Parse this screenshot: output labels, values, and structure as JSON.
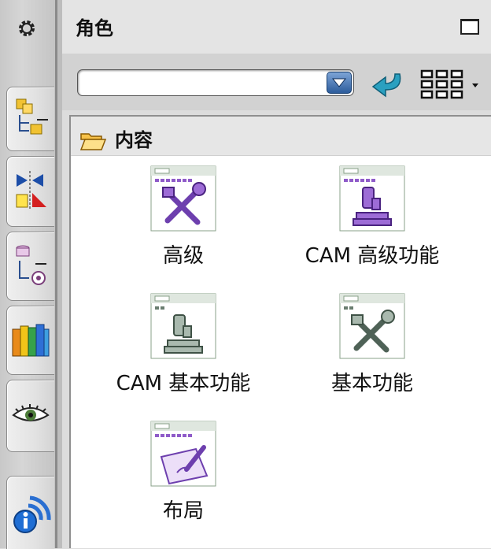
{
  "panel": {
    "title": "角色"
  },
  "toolbar": {
    "combo_value": ""
  },
  "group": {
    "label": "内容"
  },
  "items": [
    {
      "label": "高级",
      "icon": "tools-role-icon"
    },
    {
      "label": "CAM 高级功能",
      "icon": "microscope-role-icon"
    },
    {
      "label": "CAM 基本功能",
      "icon": "microscope-role-icon"
    },
    {
      "label": "基本功能",
      "icon": "tools-role-icon"
    },
    {
      "label": "布局",
      "icon": "pencil-layout-icon"
    }
  ],
  "sidebar_tabs": [
    {
      "icon": "assembly-navigator-icon"
    },
    {
      "icon": "constraint-navigator-icon"
    },
    {
      "icon": "part-navigator-icon"
    },
    {
      "icon": "reuse-library-icon"
    },
    {
      "icon": "history-eye-icon"
    },
    {
      "icon": "information-icon"
    }
  ],
  "colors": {
    "purple_accent": "#8f5bc9",
    "teal_arrow": "#2aa0c0",
    "selection_blue": "#2c5c9c"
  }
}
